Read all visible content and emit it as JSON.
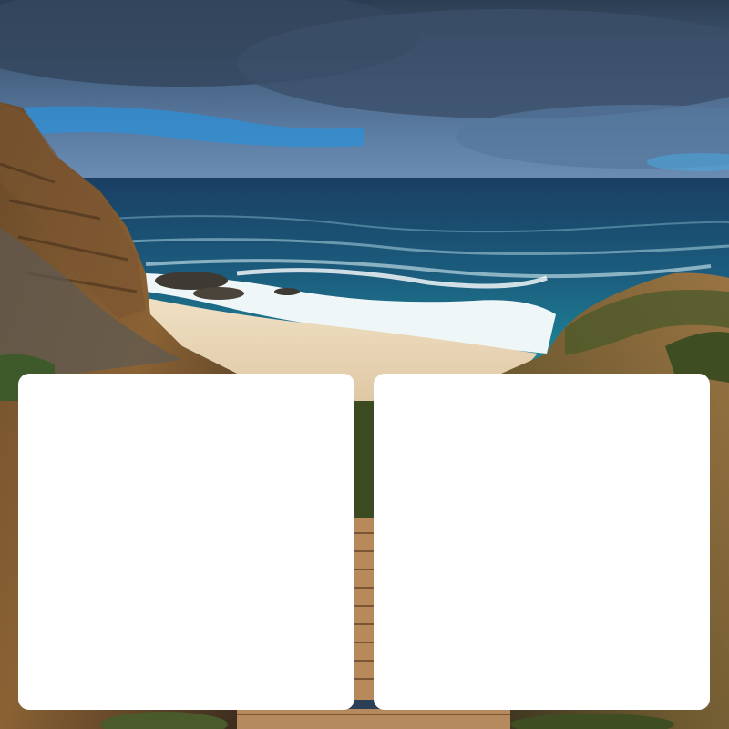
{
  "scene": {
    "description_icon": "coastal-cove-photo-icon",
    "colors": {
      "sky_dark": "#2f4560",
      "sky_mid": "#4f6f93",
      "sky_blue": "#2e8fd6",
      "ocean_deep": "#1b4f74",
      "ocean_teal": "#1e7f96",
      "surf": "#e8f2f5",
      "sand": "#e6d3b6",
      "cliff_dark": "#3f2f1f",
      "cliff_warm": "#8a6234",
      "vegetation": "#4b5a2a",
      "boardwalk": "#b8895a"
    }
  },
  "cards": [
    {
      "name": "left-card"
    },
    {
      "name": "right-card"
    }
  ]
}
